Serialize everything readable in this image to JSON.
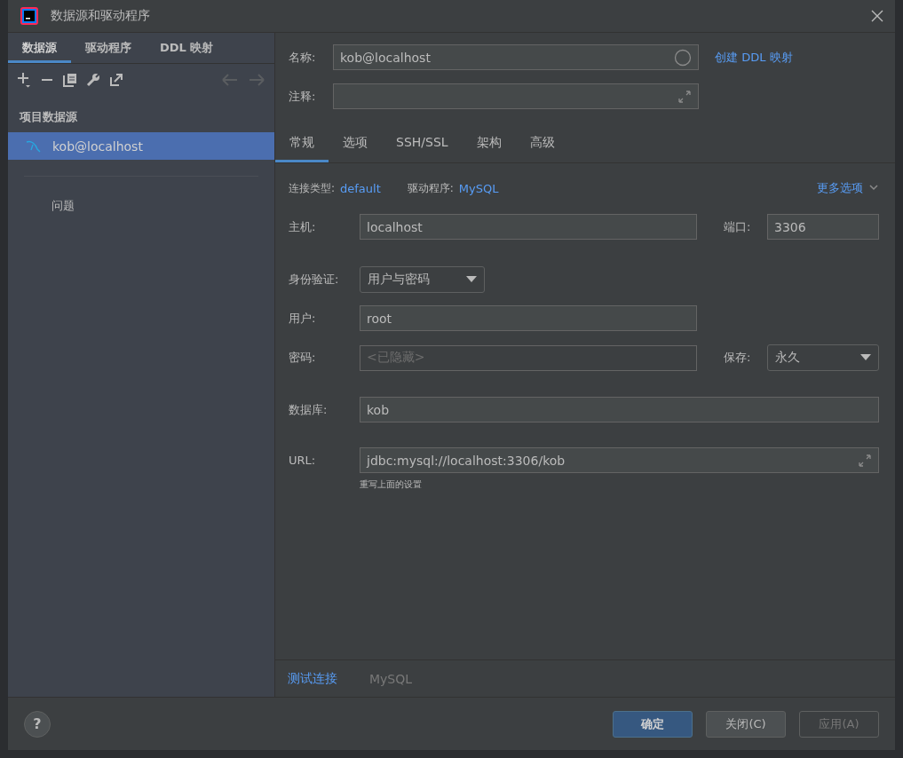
{
  "window": {
    "title": "数据源和驱动程序"
  },
  "left_tabs": [
    {
      "label": "数据源",
      "selected": true
    },
    {
      "label": "驱动程序",
      "selected": false
    },
    {
      "label": "DDL 映射",
      "selected": false
    }
  ],
  "section_header": "项目数据源",
  "datasources": [
    {
      "name": "kob@localhost",
      "selected": true
    }
  ],
  "problems": "问题",
  "name_field": {
    "label": "名称:",
    "value": "kob@localhost"
  },
  "create_ddl_link": "创建 DDL 映射",
  "comment_field": {
    "label": "注释:"
  },
  "tabs": [
    {
      "label": "常规",
      "selected": true
    },
    {
      "label": "选项",
      "selected": false
    },
    {
      "label": "SSH/SSL",
      "selected": false
    },
    {
      "label": "架构",
      "selected": false
    },
    {
      "label": "高级",
      "selected": false
    }
  ],
  "connection_info": {
    "type_label": "连接类型:",
    "type_value": "default",
    "driver_label": "驱动程序:",
    "driver_value": "MySQL",
    "more_options": "更多选项"
  },
  "host": {
    "label": "主机:",
    "value": "localhost"
  },
  "port": {
    "label": "端口:",
    "value": "3306"
  },
  "auth": {
    "label": "身份验证:",
    "value": "用户与密码"
  },
  "user": {
    "label": "用户:",
    "value": "root"
  },
  "password": {
    "label": "密码:",
    "placeholder": "<已隐藏>"
  },
  "save": {
    "label": "保存:",
    "value": "永久"
  },
  "database": {
    "label": "数据库:",
    "value": "kob"
  },
  "url": {
    "label": "URL:",
    "value": "jdbc:mysql://localhost:3306/kob",
    "hint": "重写上面的设置"
  },
  "footer": {
    "test_connection": "测试连接",
    "driver_name": "MySQL"
  },
  "help": "?",
  "buttons": [
    {
      "label": "确定",
      "kind": "primary",
      "disabled": false
    },
    {
      "label": "关闭(C)",
      "kind": "normal",
      "disabled": false
    },
    {
      "label": "应用(A)",
      "kind": "normal",
      "disabled": true
    }
  ]
}
